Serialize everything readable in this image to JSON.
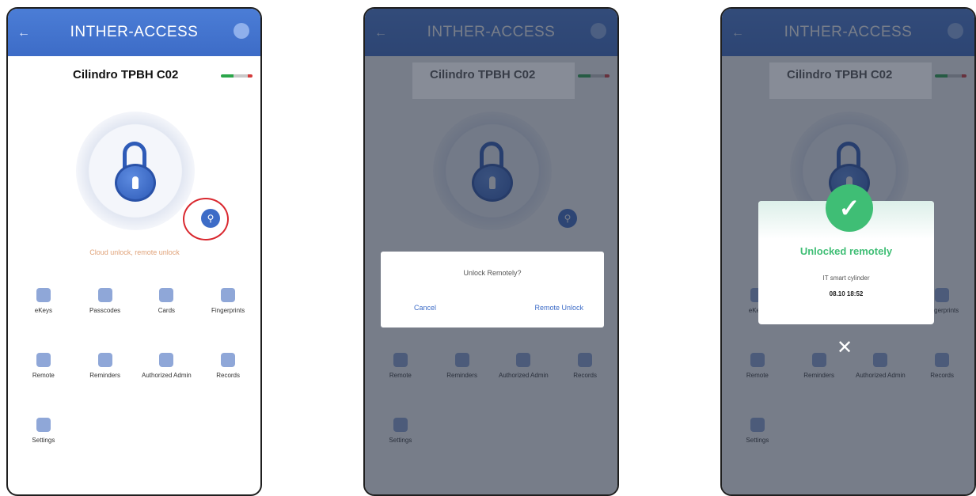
{
  "app": {
    "title": "INTHER-ACCESS",
    "device_name": "Cilindro TPBH C02"
  },
  "hint": "Cloud unlock, remote unlock",
  "grid_items": [
    "eKeys",
    "Passcodes",
    "Cards",
    "Fingerprints",
    "Remote",
    "Reminders",
    "Authorized Admin",
    "Records",
    "Settings"
  ],
  "dialog": {
    "question": "Unlock Remotely?",
    "cancel": "Cancel",
    "confirm": "Remote Unlock"
  },
  "result": {
    "title": "Unlocked remotely",
    "line1": "IT smart cylinder",
    "line2": "08.10 18:52"
  },
  "colors": {
    "header": "#3d6cc7",
    "success": "#3fbe75",
    "highlight": "#d9282f"
  }
}
